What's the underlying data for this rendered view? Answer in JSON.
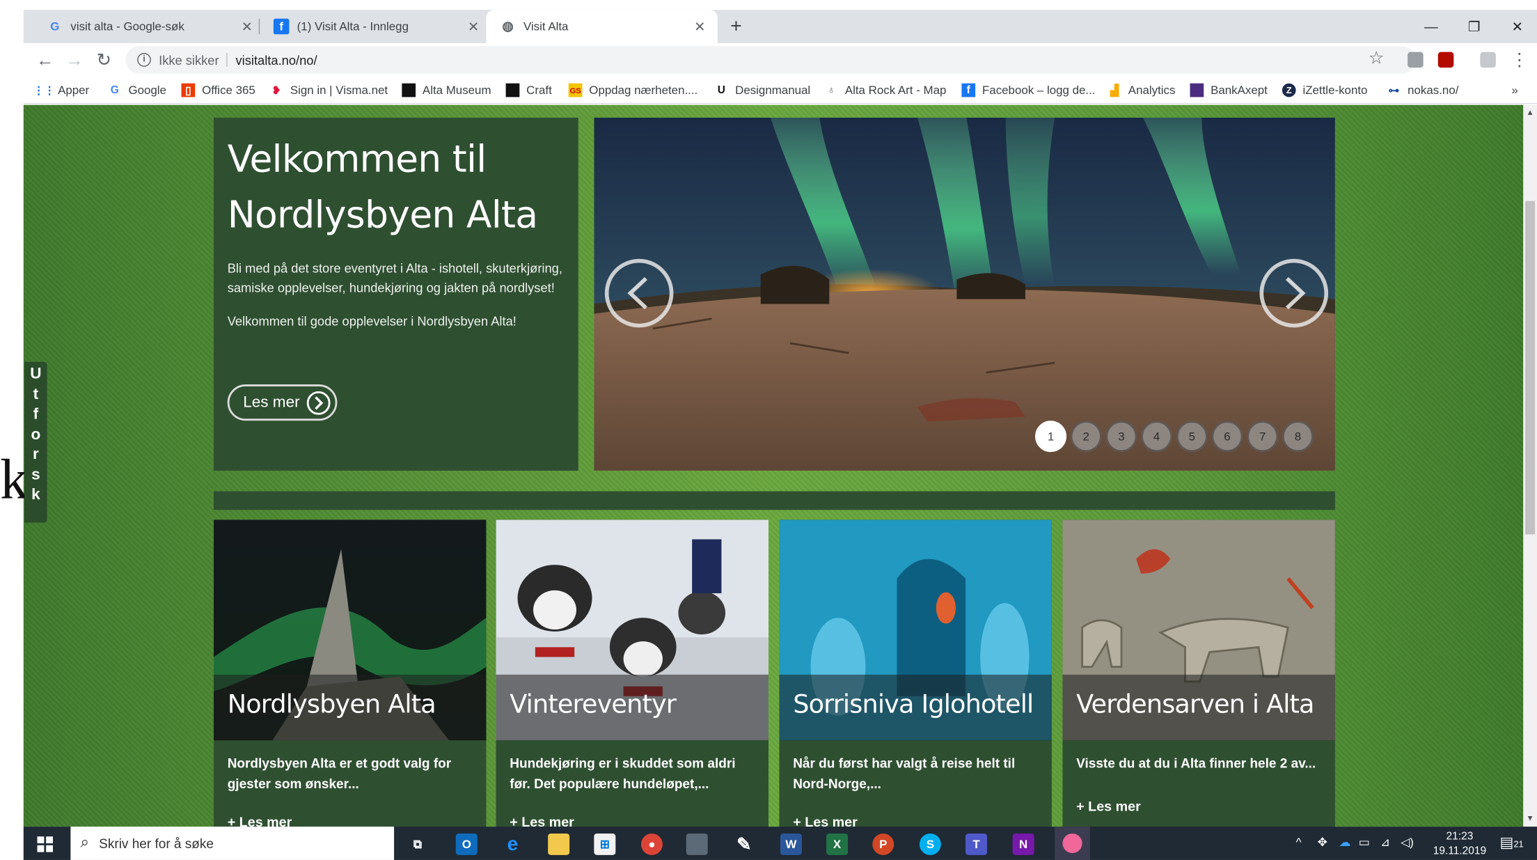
{
  "tabs": [
    {
      "title": "visit alta - Google-søk",
      "icon": "google-icon"
    },
    {
      "title": "(1) Visit Alta - Innlegg",
      "icon": "facebook-icon"
    },
    {
      "title": "Visit Alta",
      "icon": "globe-icon",
      "active": true
    }
  ],
  "address": {
    "security": "Ikke sikker",
    "url": "visitalta.no/no/"
  },
  "bookmarks": [
    {
      "label": "Apper",
      "icon": "apps-grid-icon"
    },
    {
      "label": "Google",
      "icon": "google-icon"
    },
    {
      "label": "Office 365",
      "icon": "office-icon"
    },
    {
      "label": "Sign in | Visma.net",
      "icon": "visma-icon"
    },
    {
      "label": "Alta Museum",
      "icon": "museum-icon"
    },
    {
      "label": "Craft",
      "icon": "craft-icon"
    },
    {
      "label": "Oppdag nærheten....",
      "icon": "gs-icon"
    },
    {
      "label": "Designmanual",
      "icon": "u-icon"
    },
    {
      "label": "Alta Rock Art - Map",
      "icon": "rockart-icon"
    },
    {
      "label": "Facebook – logg de...",
      "icon": "facebook-icon"
    },
    {
      "label": "Analytics",
      "icon": "analytics-icon"
    },
    {
      "label": "BankAxept",
      "icon": "bankaxept-icon"
    },
    {
      "label": "iZettle-konto",
      "icon": "izettle-icon"
    },
    {
      "label": "nokas.no/",
      "icon": "key-icon"
    }
  ],
  "side_tab": {
    "letters": [
      "U",
      "t",
      "f",
      "o",
      "r",
      "s",
      "k"
    ]
  },
  "left_fragment": "k",
  "welcome": {
    "title_line1": "Velkommen til",
    "title_line2": "Nordlysbyen Alta",
    "para1": "Bli med på det store eventyret i Alta - ishotell, skuterkjøring, samiske opplevelser, hundekjøring og jakten på nordlyset!",
    "para2": "Velkommen til gode opplevelser i Nordlysbyen Alta!",
    "button": "Les mer"
  },
  "slider": {
    "dots": [
      "1",
      "2",
      "3",
      "4",
      "5",
      "6",
      "7",
      "8"
    ],
    "active_dot": 1
  },
  "cards": [
    {
      "title": "Nordlysbyen Alta",
      "desc": "Nordlysbyen Alta er et godt valg for gjester som ønsker...",
      "more": "+ Les mer"
    },
    {
      "title": "Vintereventyr",
      "desc": "Hundekjøring er i skuddet som aldri før. Det populære hundeløpet,...",
      "more": "+ Les mer"
    },
    {
      "title": "Sorrisniva Iglohotell",
      "desc": "Når du først har valgt å reise helt til Nord-Norge,...",
      "more": "+ Les mer"
    },
    {
      "title": "Verdensarven i Alta",
      "desc": "Visste du at du i Alta finner hele 2 av...",
      "more": "+ Les mer"
    }
  ],
  "taskbar": {
    "search_placeholder": "Skriv her for å søke",
    "time": "21:23",
    "date": "19.11.2019",
    "notifications": "21"
  }
}
